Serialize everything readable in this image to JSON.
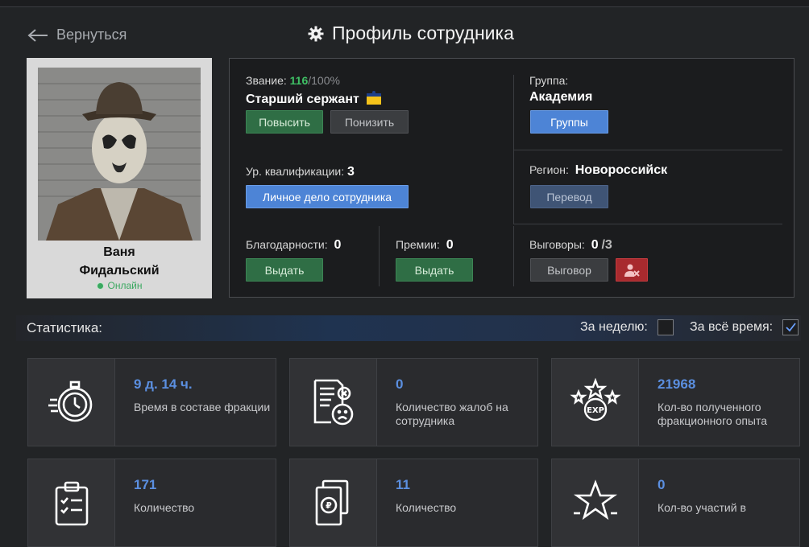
{
  "nav": {
    "back_label": "Вернуться",
    "page_title": "Профиль сотрудника"
  },
  "profile": {
    "first_name": "Ваня",
    "last_name": "Фидальский",
    "status": "Онлайн"
  },
  "rank": {
    "label": "Звание:",
    "score": "116",
    "max": "/100%",
    "name": "Старший сержант",
    "promote_label": "Повысить",
    "demote_label": "Понизить"
  },
  "group": {
    "label": "Группа:",
    "name": "Академия",
    "button_label": "Группы"
  },
  "qualification": {
    "label": "Ур. квалификации:",
    "value": "3",
    "button_label": "Личное дело сотрудника"
  },
  "region": {
    "label": "Регион:",
    "name": "Новороссийск",
    "button_label": "Перевод"
  },
  "thanks": {
    "label": "Благодарности:",
    "value": "0",
    "button_label": "Выдать"
  },
  "bonuses": {
    "label": "Премии:",
    "value": "0",
    "button_label": "Выдать"
  },
  "reprimands": {
    "label": "Выговоры:",
    "value": "0",
    "max": "/3",
    "button_label": "Выговор"
  },
  "stats": {
    "title": "Статистика:",
    "week_label": "За неделю:",
    "alltime_label": "За всё время:",
    "week_checked": false,
    "alltime_checked": true,
    "cards": [
      {
        "icon": "stopwatch-icon",
        "value": "9 д. 14 ч.",
        "label": "Время в составе фракции"
      },
      {
        "icon": "complaint-document-icon",
        "value": "0",
        "label": "Количество жалоб на сотрудника"
      },
      {
        "icon": "exp-stars-icon",
        "value": "21968",
        "label": "Кол-во полученного фракционного опыта"
      },
      {
        "icon": "clipboard-checklist-icon",
        "value": "171",
        "label": "Количество"
      },
      {
        "icon": "money-document-icon",
        "value": "11",
        "label": "Количество"
      },
      {
        "icon": "star-icon",
        "value": "0",
        "label": "Кол-во участий в"
      }
    ]
  },
  "colors": {
    "accent_blue": "#4d84d6",
    "green": "#2f6e45",
    "score_green": "#3fc065",
    "value_blue": "#5b8fe0",
    "danger_red": "#a82a2e"
  }
}
